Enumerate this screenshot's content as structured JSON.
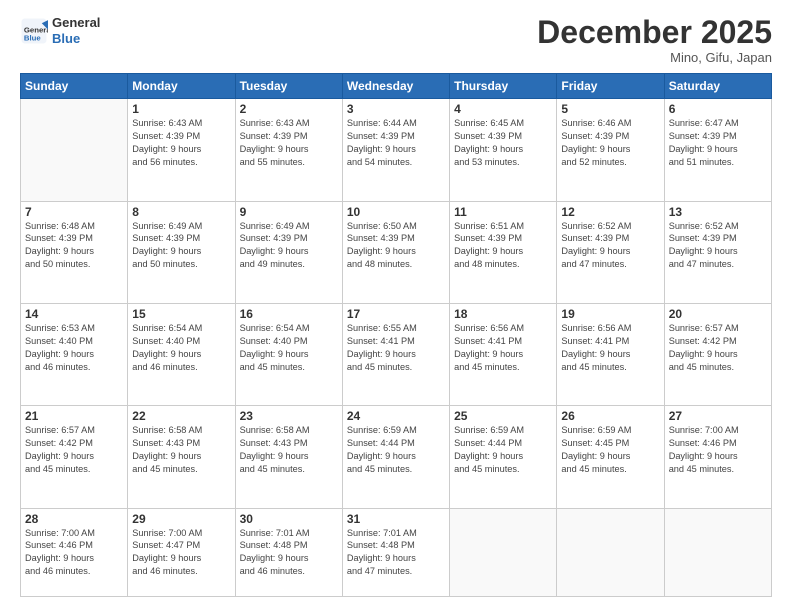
{
  "header": {
    "logo_line1": "General",
    "logo_line2": "Blue",
    "month_title": "December 2025",
    "location": "Mino, Gifu, Japan"
  },
  "weekdays": [
    "Sunday",
    "Monday",
    "Tuesday",
    "Wednesday",
    "Thursday",
    "Friday",
    "Saturday"
  ],
  "rows": [
    [
      {
        "day": "",
        "sunrise": "",
        "sunset": "",
        "daylight": ""
      },
      {
        "day": "1",
        "sunrise": "Sunrise: 6:43 AM",
        "sunset": "Sunset: 4:39 PM",
        "daylight": "Daylight: 9 hours",
        "daylight2": "and 56 minutes."
      },
      {
        "day": "2",
        "sunrise": "Sunrise: 6:43 AM",
        "sunset": "Sunset: 4:39 PM",
        "daylight": "Daylight: 9 hours",
        "daylight2": "and 55 minutes."
      },
      {
        "day": "3",
        "sunrise": "Sunrise: 6:44 AM",
        "sunset": "Sunset: 4:39 PM",
        "daylight": "Daylight: 9 hours",
        "daylight2": "and 54 minutes."
      },
      {
        "day": "4",
        "sunrise": "Sunrise: 6:45 AM",
        "sunset": "Sunset: 4:39 PM",
        "daylight": "Daylight: 9 hours",
        "daylight2": "and 53 minutes."
      },
      {
        "day": "5",
        "sunrise": "Sunrise: 6:46 AM",
        "sunset": "Sunset: 4:39 PM",
        "daylight": "Daylight: 9 hours",
        "daylight2": "and 52 minutes."
      },
      {
        "day": "6",
        "sunrise": "Sunrise: 6:47 AM",
        "sunset": "Sunset: 4:39 PM",
        "daylight": "Daylight: 9 hours",
        "daylight2": "and 51 minutes."
      }
    ],
    [
      {
        "day": "7",
        "sunrise": "Sunrise: 6:48 AM",
        "sunset": "Sunset: 4:39 PM",
        "daylight": "Daylight: 9 hours",
        "daylight2": "and 50 minutes."
      },
      {
        "day": "8",
        "sunrise": "Sunrise: 6:49 AM",
        "sunset": "Sunset: 4:39 PM",
        "daylight": "Daylight: 9 hours",
        "daylight2": "and 50 minutes."
      },
      {
        "day": "9",
        "sunrise": "Sunrise: 6:49 AM",
        "sunset": "Sunset: 4:39 PM",
        "daylight": "Daylight: 9 hours",
        "daylight2": "and 49 minutes."
      },
      {
        "day": "10",
        "sunrise": "Sunrise: 6:50 AM",
        "sunset": "Sunset: 4:39 PM",
        "daylight": "Daylight: 9 hours",
        "daylight2": "and 48 minutes."
      },
      {
        "day": "11",
        "sunrise": "Sunrise: 6:51 AM",
        "sunset": "Sunset: 4:39 PM",
        "daylight": "Daylight: 9 hours",
        "daylight2": "and 48 minutes."
      },
      {
        "day": "12",
        "sunrise": "Sunrise: 6:52 AM",
        "sunset": "Sunset: 4:39 PM",
        "daylight": "Daylight: 9 hours",
        "daylight2": "and 47 minutes."
      },
      {
        "day": "13",
        "sunrise": "Sunrise: 6:52 AM",
        "sunset": "Sunset: 4:39 PM",
        "daylight": "Daylight: 9 hours",
        "daylight2": "and 47 minutes."
      }
    ],
    [
      {
        "day": "14",
        "sunrise": "Sunrise: 6:53 AM",
        "sunset": "Sunset: 4:40 PM",
        "daylight": "Daylight: 9 hours",
        "daylight2": "and 46 minutes."
      },
      {
        "day": "15",
        "sunrise": "Sunrise: 6:54 AM",
        "sunset": "Sunset: 4:40 PM",
        "daylight": "Daylight: 9 hours",
        "daylight2": "and 46 minutes."
      },
      {
        "day": "16",
        "sunrise": "Sunrise: 6:54 AM",
        "sunset": "Sunset: 4:40 PM",
        "daylight": "Daylight: 9 hours",
        "daylight2": "and 45 minutes."
      },
      {
        "day": "17",
        "sunrise": "Sunrise: 6:55 AM",
        "sunset": "Sunset: 4:41 PM",
        "daylight": "Daylight: 9 hours",
        "daylight2": "and 45 minutes."
      },
      {
        "day": "18",
        "sunrise": "Sunrise: 6:56 AM",
        "sunset": "Sunset: 4:41 PM",
        "daylight": "Daylight: 9 hours",
        "daylight2": "and 45 minutes."
      },
      {
        "day": "19",
        "sunrise": "Sunrise: 6:56 AM",
        "sunset": "Sunset: 4:41 PM",
        "daylight": "Daylight: 9 hours",
        "daylight2": "and 45 minutes."
      },
      {
        "day": "20",
        "sunrise": "Sunrise: 6:57 AM",
        "sunset": "Sunset: 4:42 PM",
        "daylight": "Daylight: 9 hours",
        "daylight2": "and 45 minutes."
      }
    ],
    [
      {
        "day": "21",
        "sunrise": "Sunrise: 6:57 AM",
        "sunset": "Sunset: 4:42 PM",
        "daylight": "Daylight: 9 hours",
        "daylight2": "and 45 minutes."
      },
      {
        "day": "22",
        "sunrise": "Sunrise: 6:58 AM",
        "sunset": "Sunset: 4:43 PM",
        "daylight": "Daylight: 9 hours",
        "daylight2": "and 45 minutes."
      },
      {
        "day": "23",
        "sunrise": "Sunrise: 6:58 AM",
        "sunset": "Sunset: 4:43 PM",
        "daylight": "Daylight: 9 hours",
        "daylight2": "and 45 minutes."
      },
      {
        "day": "24",
        "sunrise": "Sunrise: 6:59 AM",
        "sunset": "Sunset: 4:44 PM",
        "daylight": "Daylight: 9 hours",
        "daylight2": "and 45 minutes."
      },
      {
        "day": "25",
        "sunrise": "Sunrise: 6:59 AM",
        "sunset": "Sunset: 4:44 PM",
        "daylight": "Daylight: 9 hours",
        "daylight2": "and 45 minutes."
      },
      {
        "day": "26",
        "sunrise": "Sunrise: 6:59 AM",
        "sunset": "Sunset: 4:45 PM",
        "daylight": "Daylight: 9 hours",
        "daylight2": "and 45 minutes."
      },
      {
        "day": "27",
        "sunrise": "Sunrise: 7:00 AM",
        "sunset": "Sunset: 4:46 PM",
        "daylight": "Daylight: 9 hours",
        "daylight2": "and 45 minutes."
      }
    ],
    [
      {
        "day": "28",
        "sunrise": "Sunrise: 7:00 AM",
        "sunset": "Sunset: 4:46 PM",
        "daylight": "Daylight: 9 hours",
        "daylight2": "and 46 minutes."
      },
      {
        "day": "29",
        "sunrise": "Sunrise: 7:00 AM",
        "sunset": "Sunset: 4:47 PM",
        "daylight": "Daylight: 9 hours",
        "daylight2": "and 46 minutes."
      },
      {
        "day": "30",
        "sunrise": "Sunrise: 7:01 AM",
        "sunset": "Sunset: 4:48 PM",
        "daylight": "Daylight: 9 hours",
        "daylight2": "and 46 minutes."
      },
      {
        "day": "31",
        "sunrise": "Sunrise: 7:01 AM",
        "sunset": "Sunset: 4:48 PM",
        "daylight": "Daylight: 9 hours",
        "daylight2": "and 47 minutes."
      },
      {
        "day": "",
        "sunrise": "",
        "sunset": "",
        "daylight": ""
      },
      {
        "day": "",
        "sunrise": "",
        "sunset": "",
        "daylight": ""
      },
      {
        "day": "",
        "sunrise": "",
        "sunset": "",
        "daylight": ""
      }
    ]
  ]
}
